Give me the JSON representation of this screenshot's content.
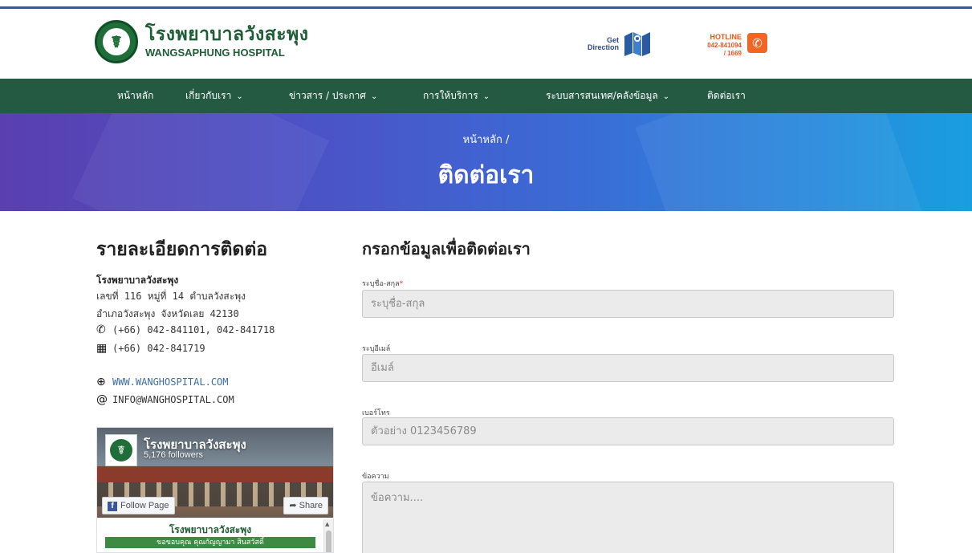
{
  "header": {
    "brand_th": "โรงพยาบาลวังสะพุง",
    "brand_en": "WANGSAPHUNG HOSPITAL",
    "get_direction_line1": "Get",
    "get_direction_line2": "Direction",
    "hotline_label": "HOTLINE",
    "hotline_number": "042-841094",
    "hotline_ext": "/ 1669"
  },
  "nav": {
    "items": [
      {
        "label": "หน้าหลัก",
        "dropdown": false
      },
      {
        "label": "เกี่ยวกับเรา",
        "dropdown": true
      },
      {
        "label": "ข่าวสาร / ประกาศ",
        "dropdown": true
      },
      {
        "label": "การให้บริการ",
        "dropdown": true
      },
      {
        "label": "ระบบสารสนเทศ/คลังข้อมูล",
        "dropdown": true
      },
      {
        "label": "ติดต่อเรา",
        "dropdown": false
      }
    ],
    "chevron": "⌄"
  },
  "banner": {
    "breadcrumb": "หน้าหลัก /",
    "title": "ติดต่อเรา"
  },
  "contact": {
    "heading": "รายละเอียดการติดต่อ",
    "org": "โรงพยาบาลวังสะพุง",
    "address_line1": "เลขที่ 116 หมู่ที่ 14 ตำบลวังสะพุง",
    "address_line2": "อำเภอวังสะพุง จังหวัดเลย 42130",
    "phone": "(+66) 042-841101, 042-841718",
    "fax": "(+66) 042-841719",
    "website": "WWW.WANGHOSPITAL.COM",
    "email": "INFO@WANGHOSPITAL.COM",
    "icons": {
      "phone": "phone-icon",
      "fax": "fax-icon",
      "web": "globe-icon",
      "email": "at-icon"
    }
  },
  "facebook": {
    "page_name": "โรงพยาบาลวังสะพุง",
    "followers": "5,176 followers",
    "follow_label": "Follow Page",
    "share_label": "Share",
    "post_title": "โรงพยาบาลวังสะพุง",
    "post_banner": "ขอขอบคุณ คุณกัญญามา สินสวัสดิ์"
  },
  "form": {
    "heading": "กรอกข้อมูลเพื่อติดต่อเรา",
    "name_label": "ระบุชื่อ-สกุล",
    "name_required": "*",
    "name_placeholder": "ระบุชื่อ-สกุล",
    "email_label": "ระบุอีเมล์",
    "email_placeholder": "อีเมล์",
    "phone_label": "เบอร์โทร",
    "phone_placeholder": "ตัวอย่าง 0123456789",
    "message_label": "ข้อความ",
    "message_placeholder": "ข้อความ...."
  },
  "colors": {
    "brand_green": "#1f5d36",
    "nav_bg": "#245a42",
    "hotline_orange": "#f26522",
    "direction_blue": "#2c4a80",
    "link_blue": "#3b6ea8"
  }
}
